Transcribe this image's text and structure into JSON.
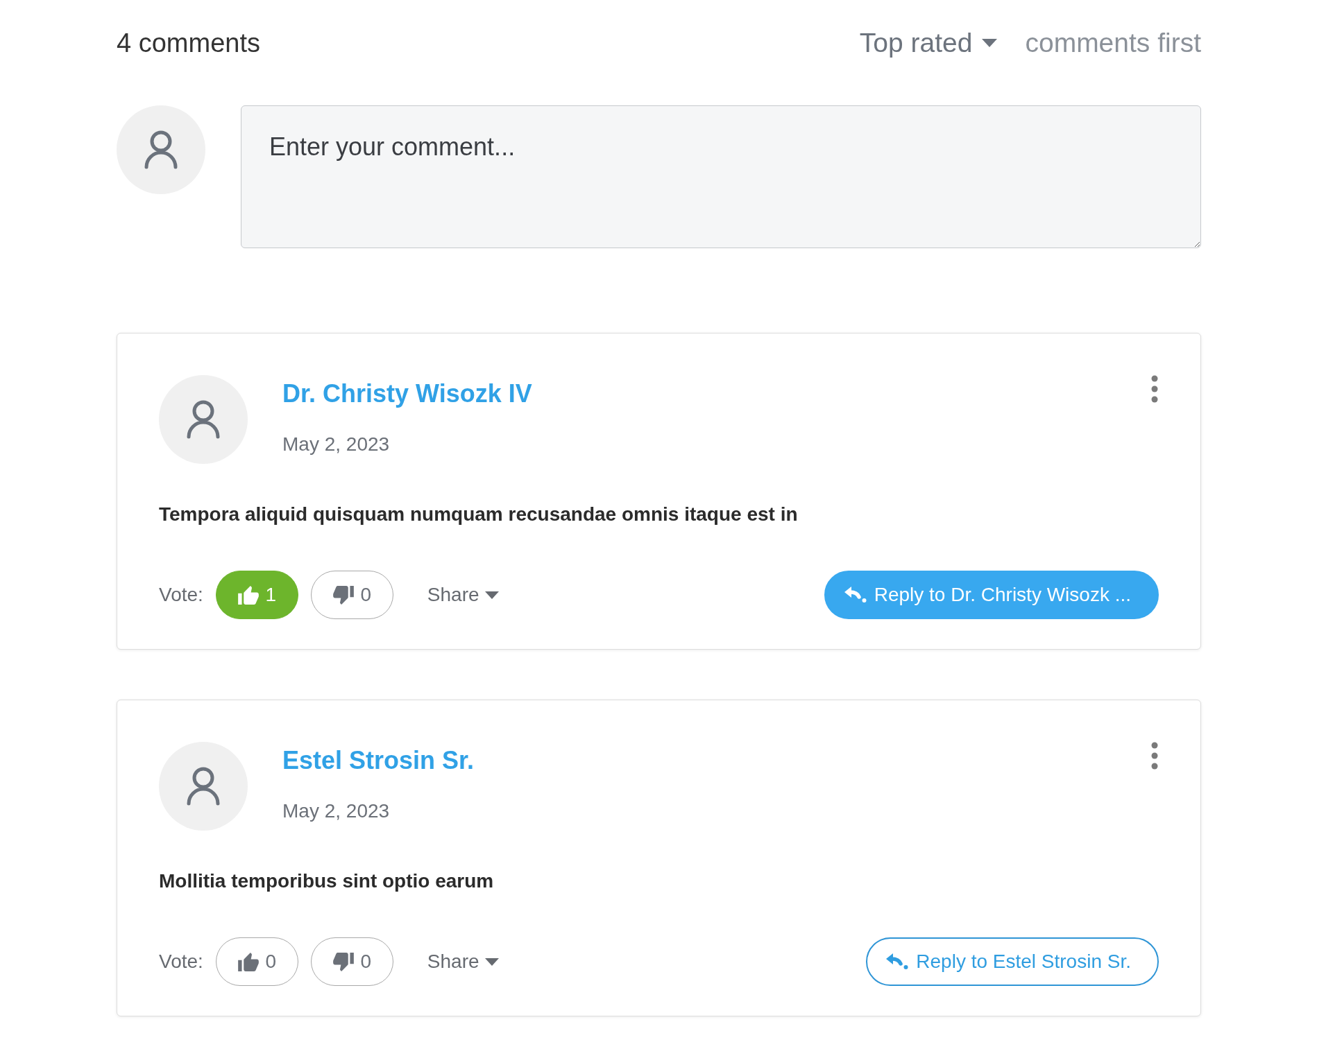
{
  "header": {
    "count": "4 comments",
    "sort": {
      "value": "Top rated",
      "suffix": "comments first"
    }
  },
  "composer": {
    "placeholder": "Enter your comment..."
  },
  "comments": [
    {
      "author": "Dr. Christy Wisozk IV",
      "date": "May 2, 2023",
      "text": "Tempora aliquid quisquam numquam recusandae omnis itaque est in",
      "vote_label": "Vote:",
      "upvote": {
        "count": "1",
        "selected": true
      },
      "downvote": {
        "count": "0",
        "selected": false
      },
      "share": "Share",
      "reply": {
        "label": "Reply to Dr. Christy Wisozk ...",
        "highlighted": true
      }
    },
    {
      "author": "Estel Strosin Sr.",
      "date": "May 2, 2023",
      "text": "Mollitia temporibus sint optio earum",
      "vote_label": "Vote:",
      "upvote": {
        "count": "0",
        "selected": false
      },
      "downvote": {
        "count": "0",
        "selected": false
      },
      "share": "Share",
      "reply": {
        "label": "Reply to Estel Strosin Sr.",
        "highlighted": false
      }
    }
  ]
}
